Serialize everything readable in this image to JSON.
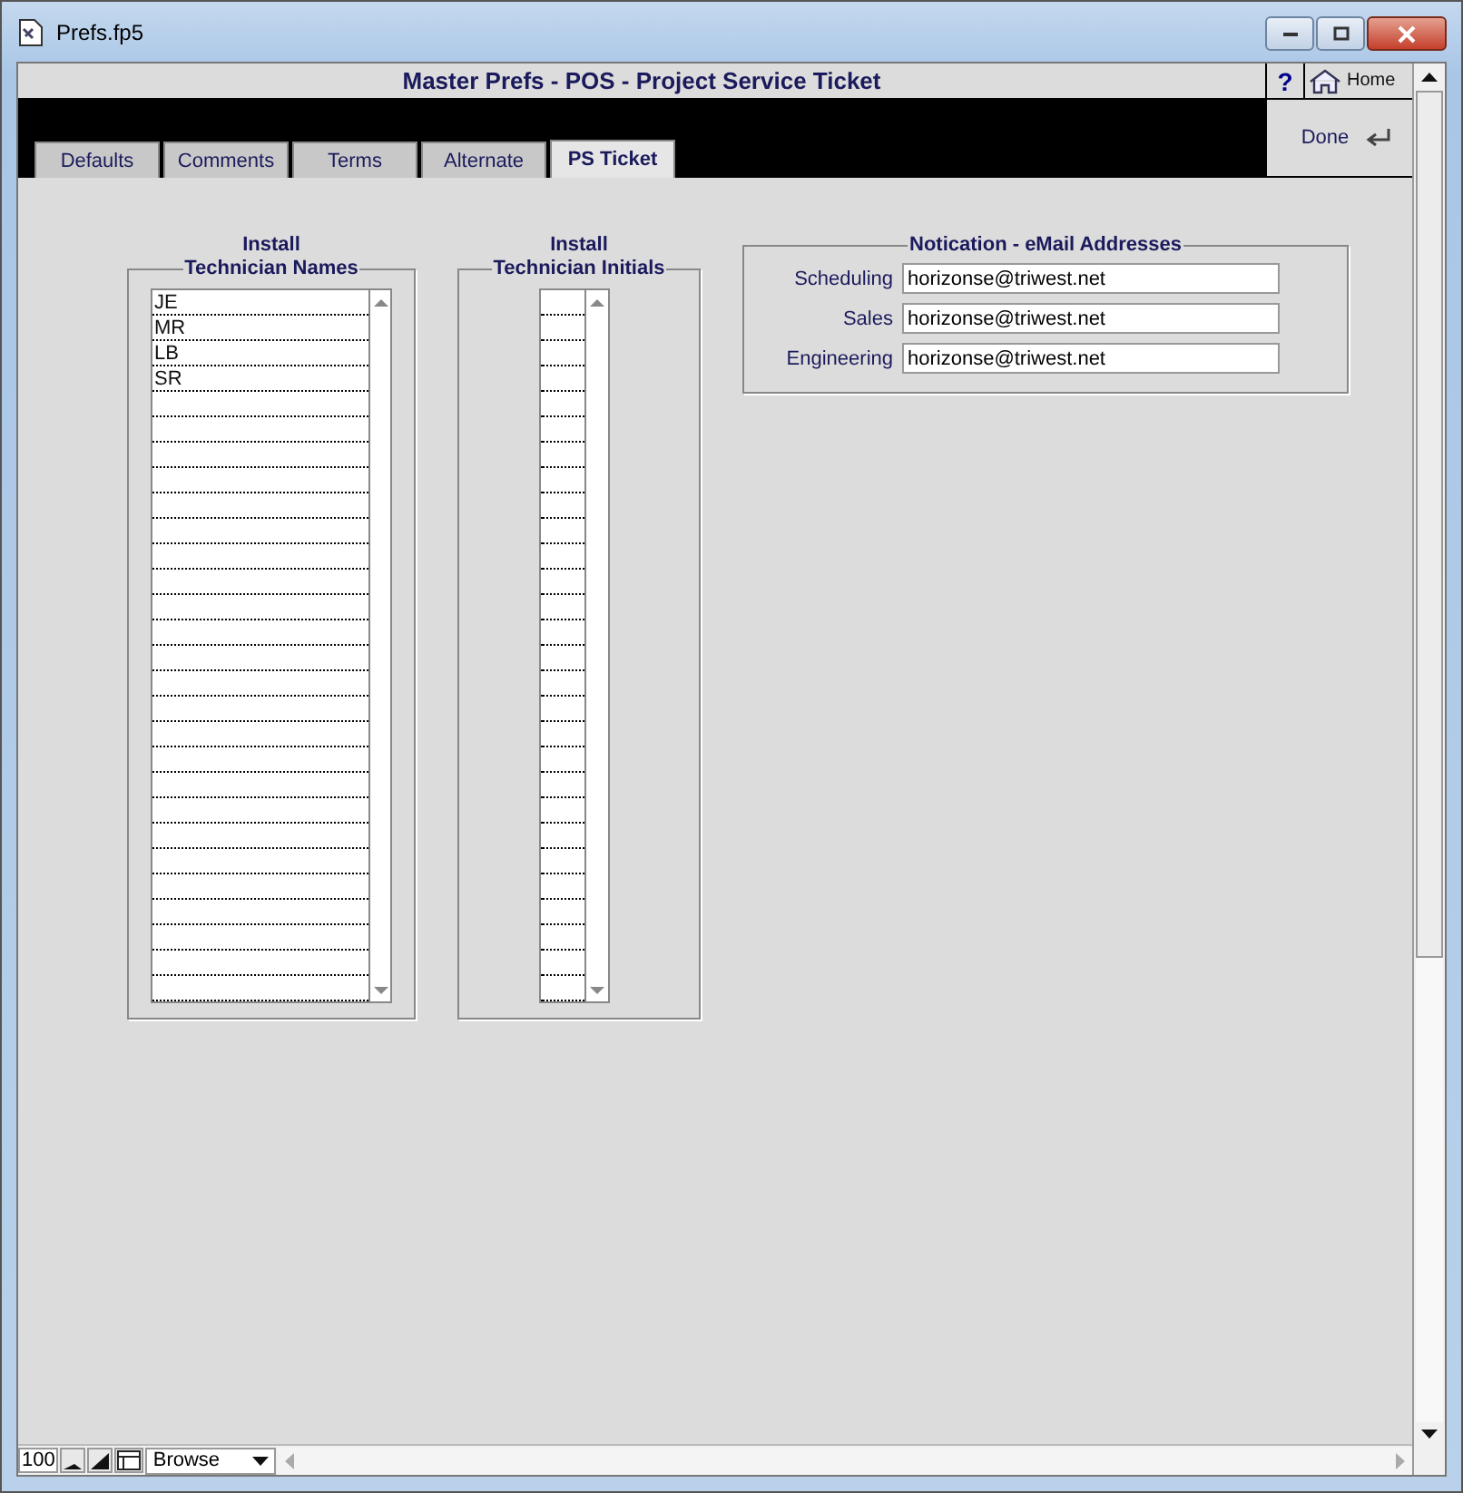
{
  "window": {
    "title": "Prefs.fp5"
  },
  "header": {
    "title": "Master Prefs - POS - Project Service Ticket",
    "help": "?",
    "home": "Home",
    "done": "Done"
  },
  "tabs": [
    {
      "label": "Defaults",
      "selected": false
    },
    {
      "label": "Comments",
      "selected": false
    },
    {
      "label": "Terms",
      "selected": false
    },
    {
      "label": "Alternate",
      "selected": false
    },
    {
      "label": "PS Ticket",
      "selected": true
    }
  ],
  "names": {
    "caption": "Install",
    "legend": "Technician Names",
    "rows": [
      "JE",
      "MR",
      "LB",
      "SR"
    ]
  },
  "initials": {
    "caption": "Install",
    "legend": "Technician Initials"
  },
  "notification": {
    "legend": "Notication - eMail Addresses",
    "fields": [
      {
        "label": "Scheduling",
        "value": "horizonse@triwest.net"
      },
      {
        "label": "Sales",
        "value": "horizonse@triwest.net"
      },
      {
        "label": "Engineering",
        "value": "horizonse@triwest.net"
      }
    ]
  },
  "status_bar": {
    "zoom": "100",
    "mode": "Browse"
  }
}
